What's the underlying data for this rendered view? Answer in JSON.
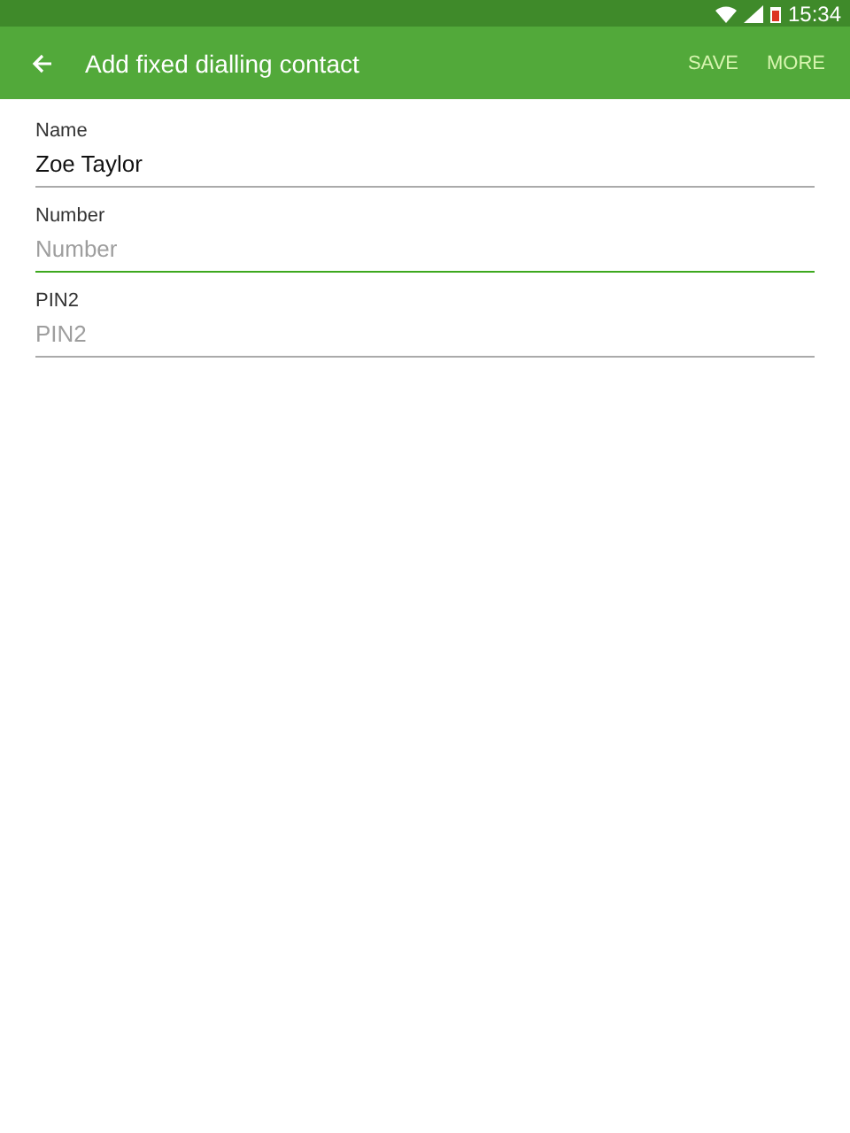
{
  "status_bar": {
    "time": "15:34"
  },
  "app_bar": {
    "title": "Add fixed dialling contact",
    "actions": [
      "SAVE",
      "MORE"
    ]
  },
  "fields": [
    {
      "label": "Name",
      "value": "Zoe Taylor",
      "focused": false
    },
    {
      "label": "Number",
      "placeholder": "Number",
      "focused": true
    },
    {
      "label": "PIN2",
      "placeholder": "PIN2",
      "focused": false
    }
  ]
}
